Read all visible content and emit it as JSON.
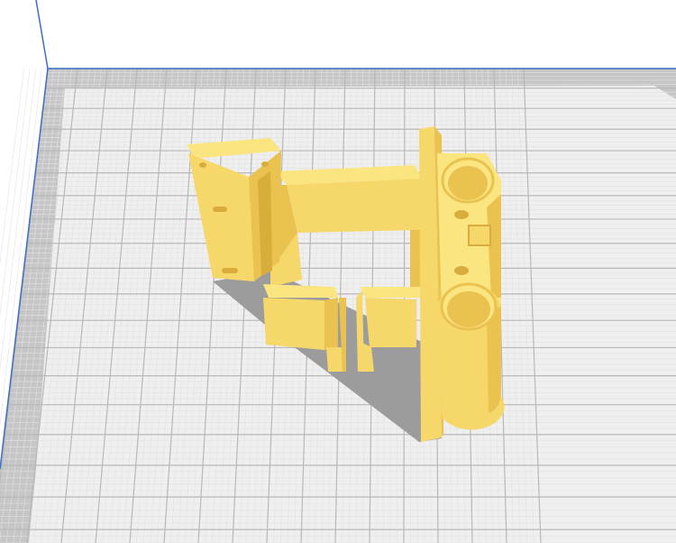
{
  "viewport": {
    "view": "3d-build-plate",
    "model": "printed-part"
  },
  "colors": {
    "background": "#ffffff",
    "axis_line": "#3a6fc4",
    "plate_border": "#c4c4c4",
    "plate_inner": "#efefef",
    "grid_major": "#b8b8b8",
    "grid_minor": "#e2e2e2",
    "model_top": "#fbe580",
    "model_front": "#f6d86a",
    "model_side": "#e9c24f",
    "model_dark": "#d9ad3c",
    "shadow": "#9c9c9c"
  }
}
